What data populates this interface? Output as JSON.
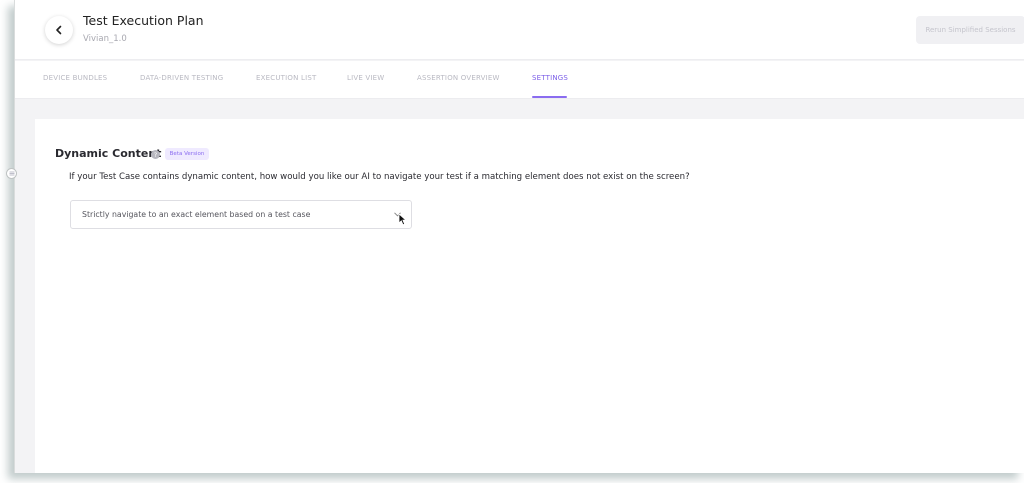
{
  "header": {
    "title": "Test Execution Plan",
    "subtitle": "Vivian_1.0",
    "back_icon": "chevron-left-icon",
    "rerun_label": "Rerun Simplified Sessions"
  },
  "tabs": [
    {
      "label": "DEVICE BUNDLES",
      "active": false
    },
    {
      "label": "DATA-DRIVEN TESTING",
      "active": false
    },
    {
      "label": "EXECUTION LIST",
      "active": false
    },
    {
      "label": "LIVE VIEW",
      "active": false
    },
    {
      "label": "ASSERTION OVERVIEW",
      "active": false
    },
    {
      "label": "SETTINGS",
      "active": true
    }
  ],
  "settings": {
    "section_title": "Dynamic Content",
    "help_icon": "question-circle-icon",
    "help_glyph": "?",
    "badge": "Beta Version",
    "question": "If your Test Case contains dynamic content, how would you like our AI to navigate your test if a matching element does not exist on the screen?",
    "select_value": "Strictly navigate to an exact element based on a test case"
  },
  "colors": {
    "accent": "#8a6cf0",
    "background": "#f3f3f5"
  }
}
